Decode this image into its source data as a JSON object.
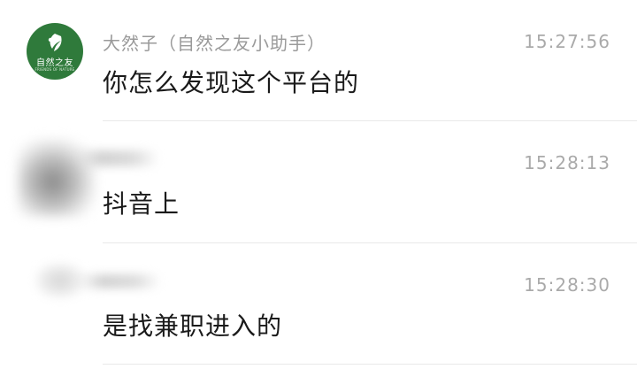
{
  "messages": [
    {
      "sender": "大然子（自然之友小助手）",
      "time": "15:27:56",
      "text": "你怎么发现这个平台的",
      "avatar": {
        "type": "brand-logo",
        "text": "自然之友",
        "subtext": "FRIENDS OF NATURE",
        "color": "#2f7a3b"
      }
    },
    {
      "sender": "",
      "time": "15:28:13",
      "text": "抖音上",
      "avatar": {
        "type": "blurred"
      }
    },
    {
      "sender": "",
      "time": "15:28:30",
      "text": "是找兼职进入的",
      "avatar": {
        "type": "blurred"
      }
    }
  ]
}
